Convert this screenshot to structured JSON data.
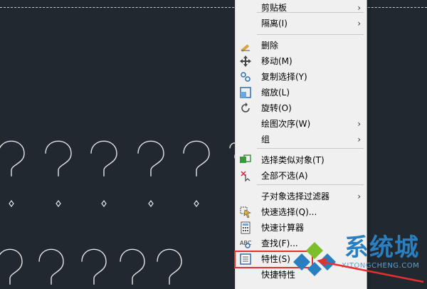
{
  "context_menu": {
    "items": [
      {
        "label": "剪贴板",
        "submenu": true,
        "icon": ""
      },
      {
        "label": "隔离(I)",
        "submenu": true,
        "icon": ""
      },
      {
        "label": "删除",
        "submenu": false,
        "icon": "eraser-icon"
      },
      {
        "label": "移动(M)",
        "submenu": false,
        "icon": "move-arrows-icon"
      },
      {
        "label": "复制选择(Y)",
        "submenu": false,
        "icon": "copy-selection-icon"
      },
      {
        "label": "缩放(L)",
        "submenu": false,
        "icon": "scale-icon"
      },
      {
        "label": "旋转(O)",
        "submenu": false,
        "icon": "rotate-icon"
      },
      {
        "label": "绘图次序(W)",
        "submenu": true,
        "icon": ""
      },
      {
        "label": "组",
        "submenu": true,
        "icon": ""
      },
      {
        "label": "选择类似对象(T)",
        "submenu": false,
        "icon": "select-similar-icon"
      },
      {
        "label": "全部不选(A)",
        "submenu": false,
        "icon": "deselect-all-icon"
      },
      {
        "label": "子对象选择过滤器",
        "submenu": true,
        "icon": ""
      },
      {
        "label": "快速选择(Q)...",
        "submenu": false,
        "icon": "quick-select-icon"
      },
      {
        "label": "快速计算器",
        "submenu": false,
        "icon": "calculator-icon"
      },
      {
        "label": "查找(F)...",
        "submenu": false,
        "icon": "find-icon"
      },
      {
        "label": "特性(S)",
        "submenu": false,
        "icon": "properties-icon"
      },
      {
        "label": "快捷特性",
        "submenu": false,
        "icon": ""
      }
    ],
    "submenu_arrow": "›",
    "highlighted_item": "特性(S)",
    "highlight_color": "#e53030"
  },
  "watermark": {
    "text": "系统城",
    "subtext": "XITONGCHENG.COM",
    "colors": {
      "blue": "#2a7fc0",
      "green": "#7cbf2a"
    }
  },
  "canvas": {
    "background": "#212830",
    "glyph_char": "?",
    "glyph_color": "#e6e6e6"
  }
}
